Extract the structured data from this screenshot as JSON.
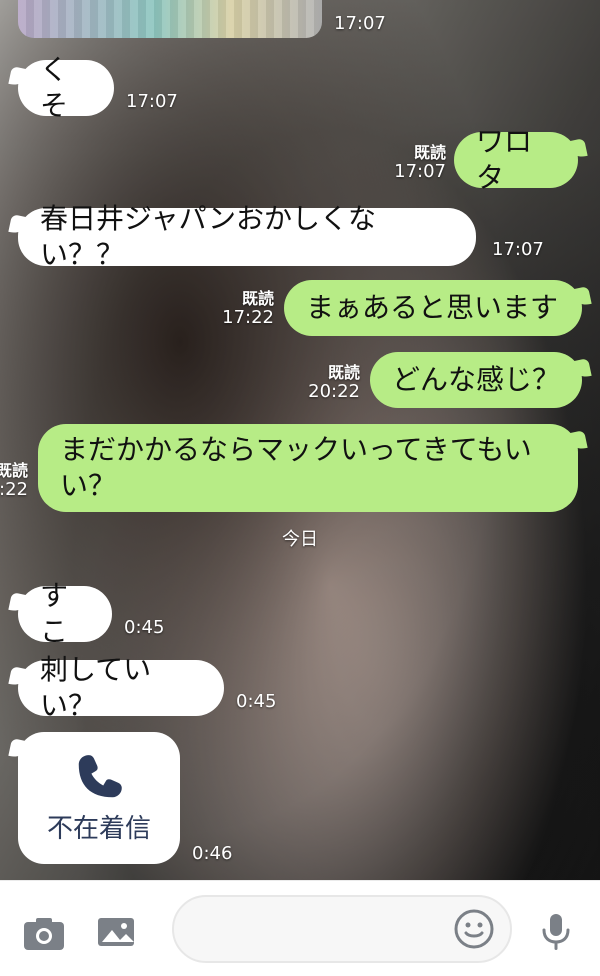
{
  "messages": [
    {
      "id": "m1",
      "direction": "incoming",
      "text": "くそ",
      "time": "17:07"
    },
    {
      "id": "m2",
      "direction": "outgoing",
      "text": "ワロタ",
      "read": "既読",
      "time": "17:07"
    },
    {
      "id": "m3",
      "direction": "incoming",
      "text": "春日井ジャパンおかしくない？？",
      "time": "17:07"
    },
    {
      "id": "m4",
      "direction": "outgoing",
      "text": "まぁあると思います",
      "read": "既読",
      "time": "17:22"
    },
    {
      "id": "m5",
      "direction": "outgoing",
      "text": "どんな感じ？",
      "read": "既読",
      "time": "20:22"
    },
    {
      "id": "m6",
      "direction": "outgoing",
      "text": "まだかかるならマックいってきてもいい？",
      "read": "既読",
      "time": ":22"
    },
    {
      "id": "m7",
      "direction": "incoming",
      "text": "すこ",
      "time": "0:45"
    },
    {
      "id": "m8",
      "direction": "incoming",
      "text": "刺していい？",
      "time": "0:45"
    }
  ],
  "top_image_message": {
    "time": "17:07"
  },
  "date_divider": {
    "label": "今日"
  },
  "call": {
    "label": "不在着信",
    "time": "0:46"
  },
  "inputbar": {
    "icons": [
      "camera-icon",
      "image-icon",
      "emoji-icon",
      "mic-icon"
    ],
    "placeholder": ""
  },
  "colors": {
    "outgoing_bubble": "#b7ec86",
    "incoming_bubble": "#ffffff",
    "inputbar_bg": "#ffffff"
  }
}
